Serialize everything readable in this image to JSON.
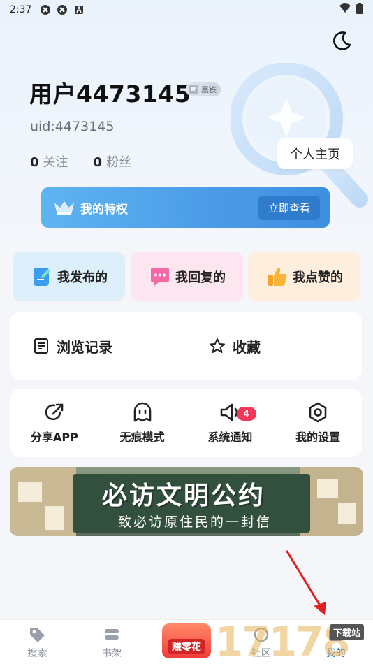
{
  "status_bar": {
    "time": "2:37"
  },
  "profile": {
    "username": "用户4473145",
    "level": "黑铁",
    "uid": "uid:4473145",
    "following_count": "0",
    "following_label": "关注",
    "followers_count": "0",
    "followers_label": "粉丝",
    "homepage_button": "个人主页"
  },
  "privilege": {
    "label": "我的特权",
    "button": "立即查看"
  },
  "quick_actions": [
    {
      "label": "我发布的",
      "icon": "edit-doc-icon"
    },
    {
      "label": "我回复的",
      "icon": "chat-bubble-icon"
    },
    {
      "label": "我点赞的",
      "icon": "thumbs-up-icon"
    }
  ],
  "history": {
    "browse": "浏览记录",
    "favorites": "收藏"
  },
  "tools": [
    {
      "label": "分享APP",
      "icon": "share-icon"
    },
    {
      "label": "无痕模式",
      "icon": "ghost-icon"
    },
    {
      "label": "系统通知",
      "icon": "speaker-icon",
      "badge": "4"
    },
    {
      "label": "我的设置",
      "icon": "settings-icon"
    }
  ],
  "banner": {
    "title": "必访文明公约",
    "subtitle": "致必访原住民的一封信"
  },
  "tabbar": {
    "search": "搜索",
    "bookshelf": "书架",
    "earn": "赚零花",
    "community": "社区",
    "me": "我的"
  },
  "watermark": {
    "digits": "17178",
    "tag": "下载站"
  },
  "colors": {
    "accent": "#2f6fd6",
    "privilege": "#4c9de8",
    "badge": "#f2375a"
  }
}
